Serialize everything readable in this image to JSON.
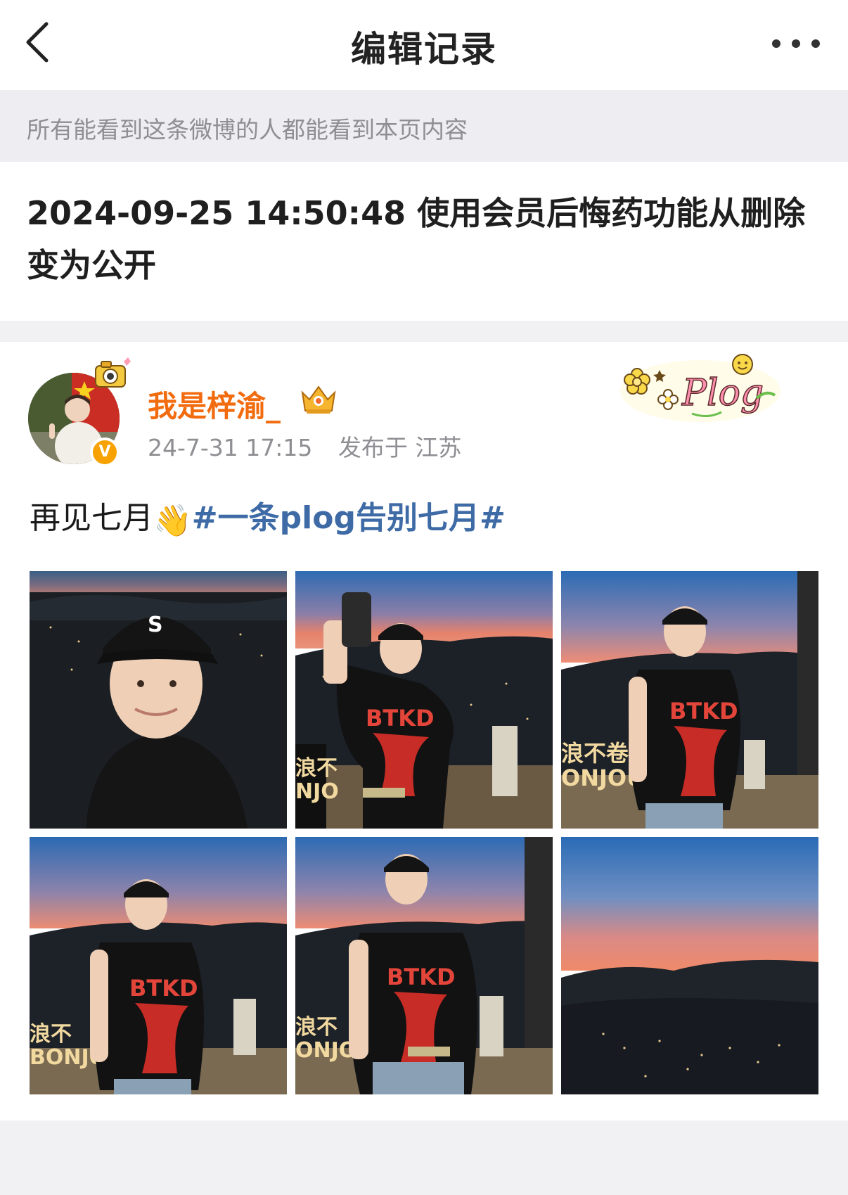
{
  "nav": {
    "title": "编辑记录"
  },
  "notice": {
    "text": "所有能看到这条微博的人都能看到本页内容"
  },
  "edit_record": {
    "text": "2024-09-25 14:50:48 使用会员后悔药功能从删除变为公开"
  },
  "post": {
    "author": {
      "name": "我是梓渝_",
      "verified_mark": "V"
    },
    "time": "24-7-31 17:15",
    "location": "发布于 江苏",
    "text_prefix": "再见七月",
    "emoji": "👋",
    "topic": "#一条plog告别七月#",
    "sticker_text": "Plog",
    "photos": [
      {
        "tshirt_text": "",
        "caption": ""
      },
      {
        "tshirt_text": "BTKD",
        "caption": "浪不\nNJO"
      },
      {
        "tshirt_text": "BTKD",
        "caption": "浪不卷\nONJOUR"
      },
      {
        "tshirt_text": "BTKD",
        "caption": "浪不\nBONJOU"
      },
      {
        "tshirt_text": "BTKD",
        "caption": "浪不\nONJO"
      },
      {
        "tshirt_text": "",
        "caption": ""
      }
    ]
  },
  "colors": {
    "accent_name": "#f26b0e",
    "topic": "#3e6ba6",
    "meta": "#8e8e93",
    "background": "#f1f1f4"
  }
}
